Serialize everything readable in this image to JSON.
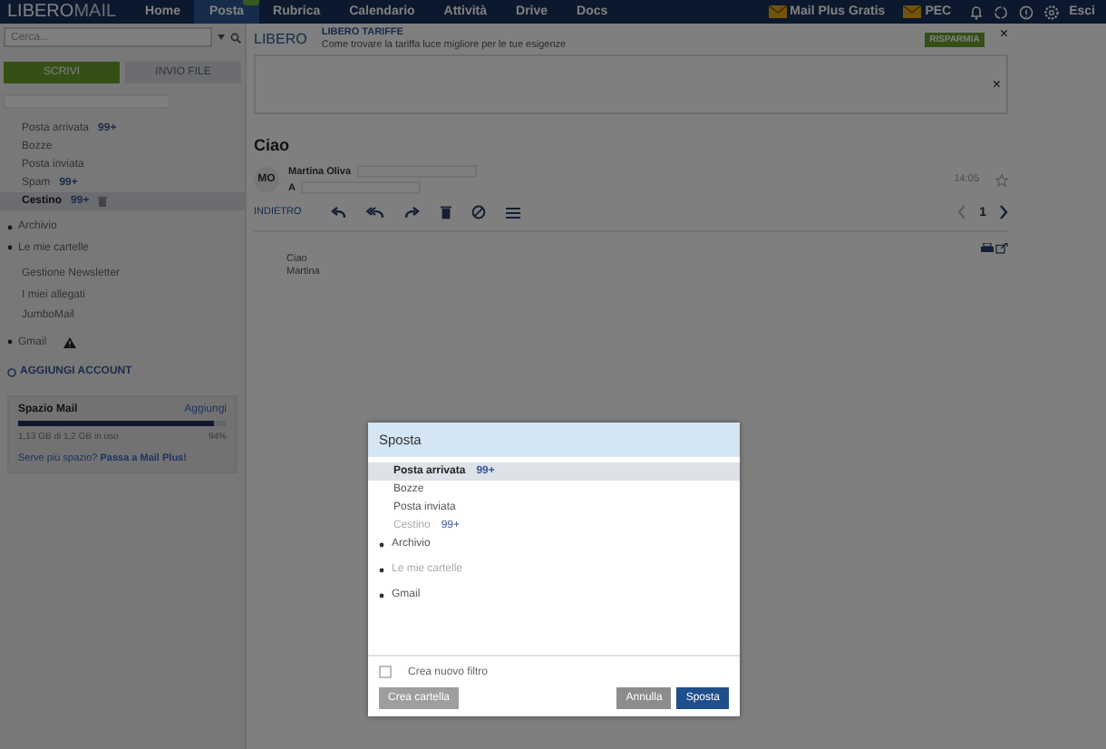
{
  "topbar": {
    "logo_main": "LIBERO",
    "logo_accent": "MAIL",
    "tabs": [
      {
        "label": "Home",
        "selected": false,
        "badge": false
      },
      {
        "label": "Posta",
        "selected": true,
        "badge": true
      },
      {
        "label": "Rubrica",
        "selected": false,
        "badge": false
      },
      {
        "label": "Calendario",
        "selected": false,
        "badge": false
      },
      {
        "label": "Attività",
        "selected": false,
        "badge": false
      },
      {
        "label": "Drive",
        "selected": false,
        "badge": false
      },
      {
        "label": "Docs",
        "selected": false,
        "badge": false
      }
    ],
    "promos": [
      "Mail Plus Gratis",
      "PEC"
    ],
    "logout": "Esci"
  },
  "sidebar": {
    "search": {
      "placeholder": "Cerca..."
    },
    "compose": "SCRIVI",
    "send_file": "INVIO FILE",
    "folders": [
      {
        "label": "Posta arrivata",
        "count": "99+",
        "selected": false,
        "trash_action": false
      },
      {
        "label": "Bozze",
        "selected": false,
        "trash_action": false
      },
      {
        "label": "Posta inviata",
        "selected": false,
        "trash_action": false
      },
      {
        "label": "Spam",
        "count": "99+",
        "selected": false,
        "trash_action": false
      },
      {
        "label": "Cestino",
        "count": "99+",
        "selected": true,
        "trash_action": true
      }
    ],
    "groups": [
      {
        "label": "Archivio",
        "kind": "expander",
        "warning": false
      },
      {
        "label": "Le mie cartelle",
        "kind": "expander",
        "warning": false
      },
      {
        "label": "Gestione Newsletter",
        "kind": "link",
        "warning": false
      },
      {
        "label": "I miei allegati",
        "kind": "link",
        "warning": false
      },
      {
        "label": "JumboMail",
        "kind": "link",
        "warning": false
      },
      {
        "label": "Gmail",
        "kind": "expander",
        "warning": true
      }
    ],
    "add_account": "AGGIUNGI ACCOUNT",
    "storage": {
      "title": "Spazio Mail",
      "action": "Aggiungi",
      "level": 0.94,
      "usage": "1,13 GB di 1,2 GB in uso",
      "percent": "94%",
      "upsell": "Serve più spazio? **Passa a Mail Plus!**"
    }
  },
  "ad": {
    "brand": "LIBERO",
    "title": "LIBERO TARIFFE",
    "text": "Come trovare la tariffa luce migliore per le tue esigenze",
    "button": "RISPARMIA",
    "close": "×",
    "close_2": "×"
  },
  "message": {
    "subject": "Ciao",
    "avatar": "MO",
    "sender": "Martina Oliva",
    "to_label": "A",
    "time": "14:05",
    "starred": false,
    "back": "INDIETRO",
    "page": "1",
    "body": [
      "Ciao",
      "Martina"
    ]
  },
  "dialog": {
    "title": "Sposta",
    "folders": [
      {
        "label": "Posta arrivata",
        "count": "99+",
        "kind": "folder",
        "selected": true,
        "disabled": false
      },
      {
        "label": "Bozze",
        "kind": "folder",
        "selected": false,
        "disabled": false
      },
      {
        "label": "Posta inviata",
        "kind": "folder",
        "selected": false,
        "disabled": false
      },
      {
        "label": "Cestino",
        "count": "99+",
        "kind": "folder",
        "selected": false,
        "disabled": true
      },
      {
        "label": "Archivio",
        "kind": "group",
        "selected": false,
        "disabled": false
      },
      {
        "label": "Le mie cartelle",
        "kind": "group",
        "selected": false,
        "disabled": true
      },
      {
        "label": "Gmail",
        "kind": "group",
        "selected": false,
        "disabled": false
      }
    ],
    "filter": {
      "label": "Crea nuovo filtro",
      "checked": false
    },
    "buttons": [
      {
        "label": "Crea cartella",
        "kind": "secondary",
        "disabled": true
      },
      {
        "label": "Annulla",
        "kind": "cancel",
        "disabled": false
      },
      {
        "label": "Sposta",
        "kind": "primary",
        "disabled": false
      }
    ]
  }
}
